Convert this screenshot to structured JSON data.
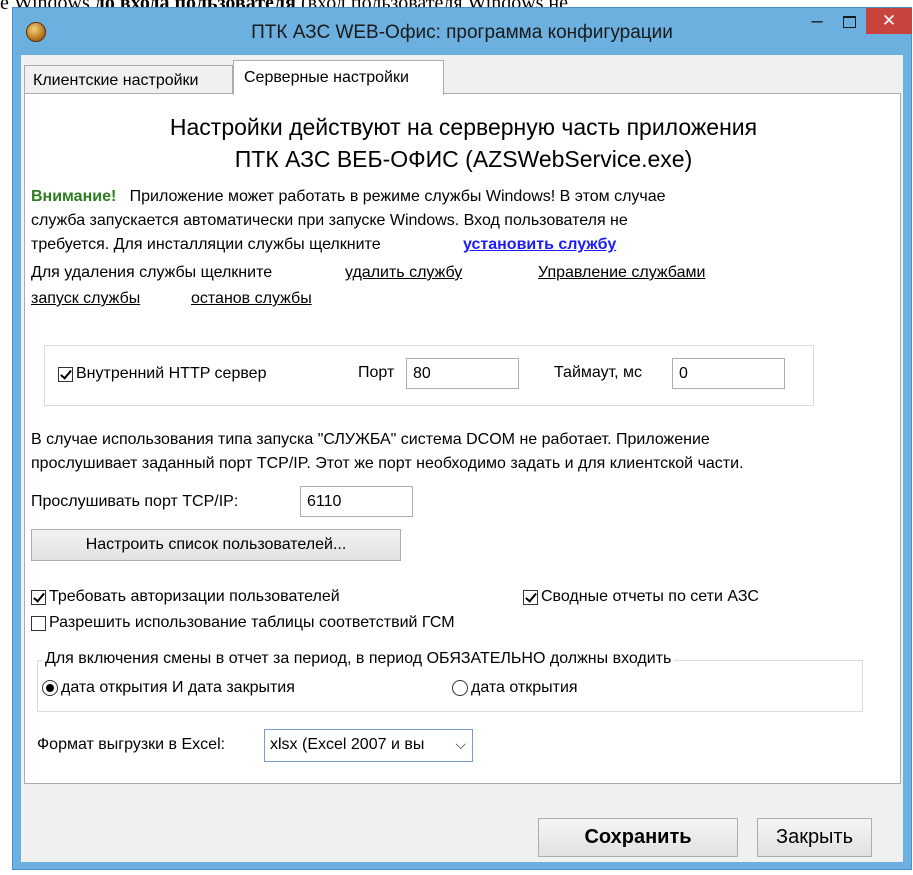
{
  "background_text": {
    "part1": "е Windows ",
    "bold": "до входа пользователя",
    "part2": " (вход пользователя Windows не"
  },
  "window": {
    "title": "ПТК АЗС WEB-Офис: программа конфигурации",
    "minimize": "–",
    "close": "✕"
  },
  "tabs": [
    {
      "label": "Клиентские настройки",
      "active": false
    },
    {
      "label": "Серверные настройки",
      "active": true
    }
  ],
  "header": {
    "line1": "Настройки действуют на серверную часть приложения",
    "line2": "ПТК АЗС ВЕБ-ОФИС (AZSWebService.exe)"
  },
  "warning": {
    "label": "Внимание!",
    "line1": "Приложение может работать в режиме службы Windows! В этом случае",
    "line2": "служба запускается автоматически при запуске Windows. Вход пользователя не",
    "line3": "требуется. Для инсталляции службы щелкните",
    "install_link": "установить службу",
    "remove_prefix": "Для удаления службы щелкните",
    "remove_link": "удалить службу",
    "manage_link": "Управление службами",
    "start_link": "запуск службы",
    "stop_link": "останов службы"
  },
  "http": {
    "checkbox_label": "Внутренний HTTP сервер",
    "checked": true,
    "port_label": "Порт",
    "port_value": "80",
    "timeout_label": "Таймаут, мс",
    "timeout_value": "0"
  },
  "dcom_note": {
    "line1": "В случае использования типа запуска \"СЛУЖБА\" система DCOM не работает. Приложение",
    "line2": "прослушивает заданный порт TCP/IP. Этот же порт необходимо задать и для клиентской части."
  },
  "tcp": {
    "label": "Прослушивать порт TCP/IP:",
    "value": "6110"
  },
  "users_button": "Настроить список пользователей...",
  "options": {
    "require_auth": {
      "label": "Требовать авторизации пользователей",
      "checked": true
    },
    "network_reports": {
      "label": "Сводные отчеты по сети АЗС",
      "checked": true
    },
    "fuel_table": {
      "label": "Разрешить использование таблицы соответствий ГСМ",
      "checked": false
    }
  },
  "shift_group": {
    "caption": "Для включения смены в отчет за период, в период ОБЯЗАТЕЛЬНО должны входить",
    "option1": "дата открытия И дата закрытия",
    "option2": "дата открытия",
    "selected": 1
  },
  "excel": {
    "label": "Формат выгрузки в Excel:",
    "selected": "xlsx (Excel 2007 и вы"
  },
  "buttons": {
    "save": "Сохранить",
    "close": "Закрыть"
  },
  "colors": {
    "frame": "#6cb0df",
    "close_button": "#c7443c",
    "warning": "#2e7d20",
    "install_link": "#1a1aff"
  }
}
